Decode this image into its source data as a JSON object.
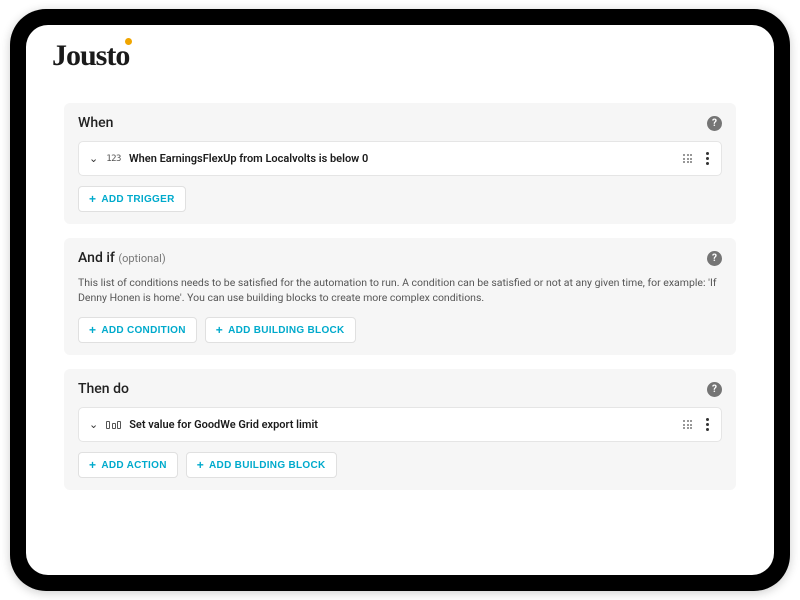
{
  "logo": "Jousto",
  "sections": {
    "when": {
      "title": "When",
      "trigger_text": "When EarningsFlexUp from Localvolts is below 0",
      "add_trigger": "ADD TRIGGER"
    },
    "andif": {
      "title": "And if",
      "optional": "(optional)",
      "description": "This list of conditions needs to be satisfied for the automation to run. A condition can be satisfied or not at any given time, for example: 'If Denny Honen is home'. You can use building blocks to create more complex conditions.",
      "add_condition": "ADD CONDITION",
      "add_building_block": "ADD BUILDING BLOCK"
    },
    "thendo": {
      "title": "Then do",
      "action_text": "Set value for GoodWe Grid export limit",
      "add_action": "ADD ACTION",
      "add_building_block": "ADD BUILDING BLOCK"
    }
  }
}
